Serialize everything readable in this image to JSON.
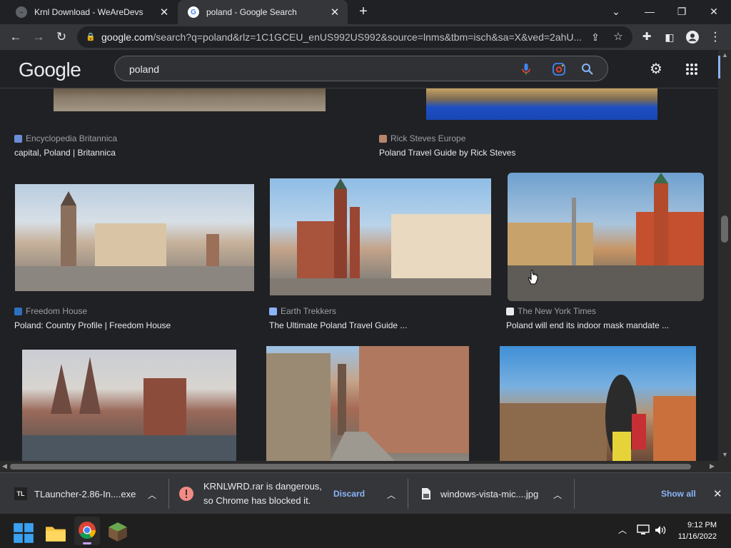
{
  "browser": {
    "tabs": [
      {
        "title": "Krnl Download - WeAreDevs",
        "active": false
      },
      {
        "title": "poland - Google Search",
        "active": true
      }
    ],
    "url_host": "google.com",
    "url_path": "/search?q=poland&rlz=1C1GCEU_enUS992US992&source=lnms&tbm=isch&sa=X&ved=2ahU..."
  },
  "google": {
    "logo": "Google",
    "query": "poland"
  },
  "results": [
    {
      "source": "Encyclopedia Britannica",
      "caption": "capital, Poland | Britannica"
    },
    {
      "source": "Rick Steves Europe",
      "caption": "Poland Travel Guide by Rick Steves"
    },
    {
      "source": "Freedom House",
      "caption": "Poland: Country Profile | Freedom House"
    },
    {
      "source": "Earth Trekkers",
      "caption": "The Ultimate Poland Travel Guide ..."
    },
    {
      "source": "The New York Times",
      "caption": "Poland will end its indoor mask mandate ..."
    }
  ],
  "downloads": {
    "item1": "TLauncher-2.86-In....exe",
    "item1_icon_text": "TL",
    "warning_line1": "KRNLWRD.rar is dangerous,",
    "warning_line2": "so Chrome has blocked it.",
    "discard": "Discard",
    "item3": "windows-vista-mic....jpg",
    "show_all": "Show all"
  },
  "taskbar": {
    "time": "9:12 PM",
    "date": "11/16/2022"
  },
  "colors": {
    "page_bg": "#202124",
    "toolbar_bg": "#35363a",
    "link_blue": "#8ab4f8",
    "danger_red": "#f28b82"
  }
}
